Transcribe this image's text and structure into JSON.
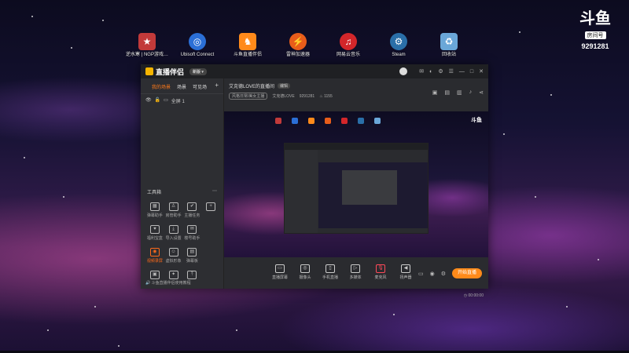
{
  "desktop": {
    "icons": [
      {
        "label": "逆水寒 | NGP游戏…",
        "color": "#c23a3a",
        "glyph": "game-icon"
      },
      {
        "label": "Ubisoft Connect",
        "color": "#2b6fd6",
        "glyph": "ubisoft-icon"
      },
      {
        "label": "斗鱼直播伴侣",
        "color": "#ff8a1a",
        "glyph": "douyu-icon"
      },
      {
        "label": "雷神加速器",
        "color": "#e85d1a",
        "glyph": "accelerator-icon"
      },
      {
        "label": "网易云音乐",
        "color": "#d3262a",
        "glyph": "music-icon"
      },
      {
        "label": "Steam",
        "color": "#2a6fa8",
        "glyph": "steam-icon"
      },
      {
        "label": "回收站",
        "color": "#6aa7d8",
        "glyph": "recycle-bin-icon"
      }
    ]
  },
  "overlay": {
    "logo": "斗鱼",
    "room_label": "房间号",
    "room_id": "9291281"
  },
  "app": {
    "brand": "直播伴侣",
    "badge": "新版 ▾",
    "left_tabs": [
      "我的场景",
      "场景",
      "可见场"
    ],
    "scene_item": "全屏 1",
    "tools_title": "工具箱",
    "tools": [
      {
        "label": "弹幕助手",
        "glyph": "▦"
      },
      {
        "label": "房管助手",
        "glyph": "♙"
      },
      {
        "label": "主播任务",
        "glyph": "✔"
      },
      {
        "label": "",
        "glyph": "+"
      },
      {
        "label": "福利宝盒",
        "glyph": "♥"
      },
      {
        "label": "导入设置",
        "glyph": "⤓"
      },
      {
        "label": "楼号助手",
        "glyph": "✉"
      },
      {
        "label": "",
        "glyph": ""
      },
      {
        "label": "视频录屏",
        "glyph": "◉",
        "highlight": true
      },
      {
        "label": "虚拟形象",
        "glyph": "☺"
      },
      {
        "label": "弹幕板",
        "glyph": "▤"
      },
      {
        "label": "",
        "glyph": ""
      },
      {
        "label": "",
        "glyph": "▣"
      },
      {
        "label": "",
        "glyph": "✦"
      },
      {
        "label": "",
        "glyph": "⤒"
      },
      {
        "label": "",
        "glyph": ""
      }
    ],
    "footer_tip": "斗鱼直播伴侣使用教程",
    "room_title": "艾克德LOVE的直播间",
    "title_pill": "编辑",
    "category": "风格日常/美女主播",
    "streamer": "艾克德LOVE",
    "room_no": "9291281",
    "fans": "1155",
    "controls": [
      {
        "label": "直播屏幕",
        "glyph": "▭"
      },
      {
        "label": "摄像头",
        "glyph": "◎"
      },
      {
        "label": "手机直播",
        "glyph": "▯"
      },
      {
        "label": "多媒体",
        "glyph": "▷"
      },
      {
        "label": "麦克风",
        "glyph": "🎙",
        "mic": true
      },
      {
        "label": "扬声器",
        "glyph": "◀"
      }
    ],
    "start_button": "开始直播",
    "timer": "00:00:00"
  }
}
